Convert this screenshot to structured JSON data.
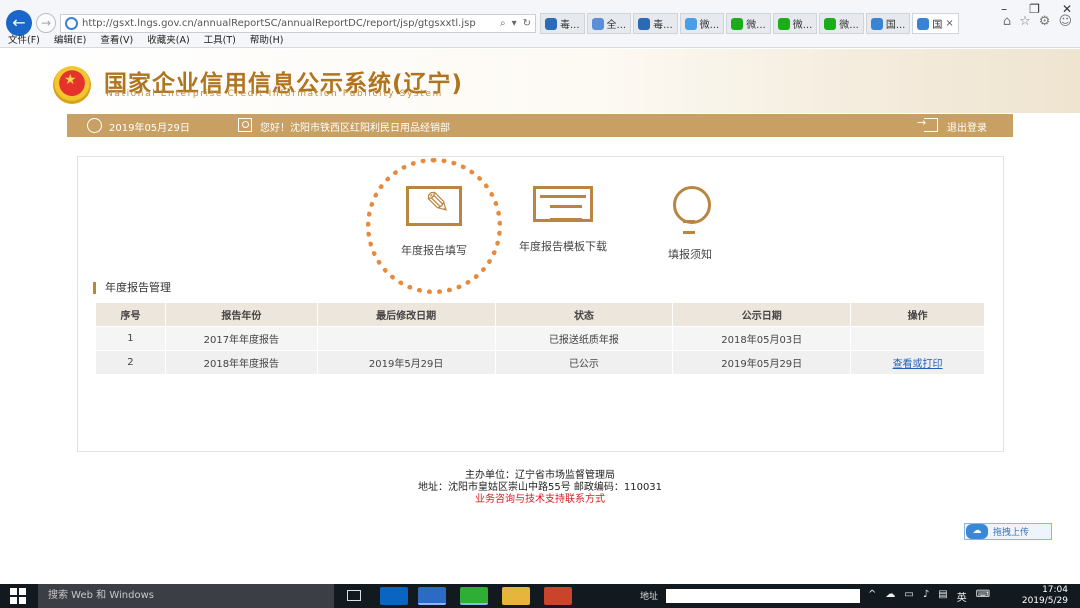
{
  "browser": {
    "url": "http://gsxt.lngs.gov.cn/annualReportSC/annualReportDC/report/jsp/gtgsxxtl.jsp",
    "tabs": [
      {
        "label": "毒...",
        "color": "#2c6ab5"
      },
      {
        "label": "全...",
        "color": "#5b8ed8"
      },
      {
        "label": "毒...",
        "color": "#2c6ab5"
      },
      {
        "label": "微...",
        "color": "#4a9ee8"
      },
      {
        "label": "微...",
        "color": "#1aad19"
      },
      {
        "label": "微...",
        "color": "#1aad19"
      },
      {
        "label": "微...",
        "color": "#1aad19"
      },
      {
        "label": "国...",
        "color": "#3a83d4"
      },
      {
        "label": "国",
        "color": "#3a83d4"
      }
    ],
    "menu": [
      "文件(F)",
      "编辑(E)",
      "查看(V)",
      "收藏夹(A)",
      "工具(T)",
      "帮助(H)"
    ]
  },
  "site": {
    "title": "国家企业信用信息公示系统(辽宁)",
    "subtitle": "National  Enterprise  Credit  Information  Publicity  System",
    "date": "2019年05月29日",
    "greeting": "您好！沈阳市铁西区红阳利民日用品经销部",
    "logout": "退出登录"
  },
  "features": [
    {
      "label": "年度报告填写"
    },
    {
      "label": "年度报告模板下载"
    },
    {
      "label": "填报须知"
    }
  ],
  "reports": {
    "section_title": "年度报告管理",
    "headers": [
      "序号",
      "报告年份",
      "最后修改日期",
      "状态",
      "公示日期",
      "操作"
    ],
    "rows": [
      {
        "no": "1",
        "year": "2017年年度报告",
        "modified": "",
        "status": "已报送纸质年报",
        "published": "2018年05月03日",
        "action": ""
      },
      {
        "no": "2",
        "year": "2018年年度报告",
        "modified": "2019年5月29日",
        "status": "已公示",
        "published": "2019年05月29日",
        "action": "查看或打印"
      }
    ]
  },
  "footer": {
    "sponsor": "主办单位：辽宁省市场监督管理局",
    "address": "地址：沈阳市皇姑区崇山中路55号 邮政编码：110031",
    "contact": "业务咨询与技术支持联系方式",
    "upload": "拖拽上传"
  },
  "taskbar": {
    "search_placeholder": "搜索 Web 和 Windows",
    "address_label": "地址",
    "tray_ime": "英",
    "time": "17:04",
    "date": "2019/5/29"
  }
}
